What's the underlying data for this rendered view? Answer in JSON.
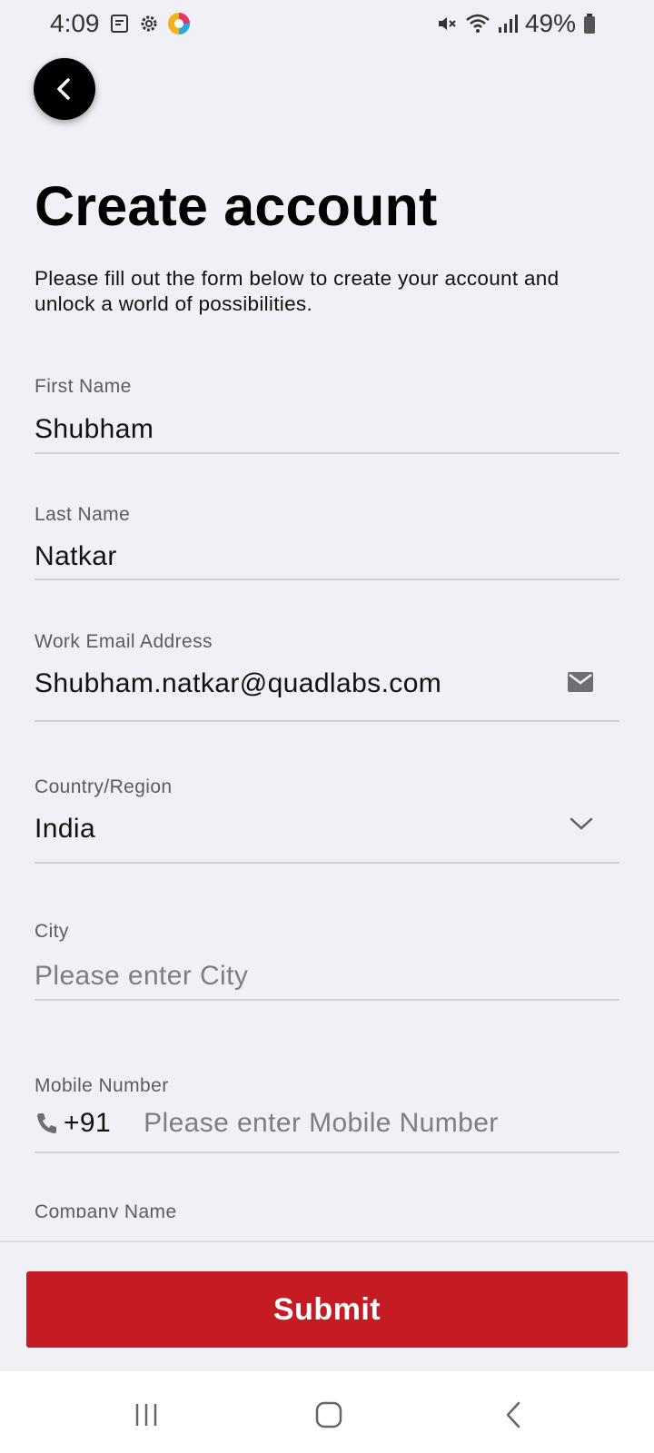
{
  "status_bar": {
    "time": "4:09",
    "battery_percent": "49%",
    "left_icons": [
      "notes-icon",
      "gear-icon",
      "app-icon"
    ],
    "right_icons": [
      "mute-icon",
      "wifi-icon",
      "signal-icon",
      "battery-icon"
    ]
  },
  "header": {
    "title": "Create account",
    "subtitle": "Please fill out the form below to create your account and unlock a world of possibilities."
  },
  "form": {
    "first_name": {
      "label": "First Name",
      "value": "Shubham"
    },
    "last_name": {
      "label": "Last Name",
      "value": "Natkar"
    },
    "email": {
      "label": "Work Email Address",
      "value": "Shubham.natkar@quadlabs.com",
      "icon": "mail-icon"
    },
    "country": {
      "label": "Country/Region",
      "value": "India",
      "icon": "chevron-down-icon"
    },
    "city": {
      "label": "City",
      "placeholder": "Please enter City"
    },
    "mobile": {
      "label": "Mobile Number",
      "prefix": "+91",
      "placeholder": "Please enter Mobile Number",
      "icon": "phone-icon"
    },
    "company": {
      "label": "Company Name"
    }
  },
  "actions": {
    "submit_label": "Submit"
  },
  "colors": {
    "accent": "#c51b22",
    "background": "#f1f0f6",
    "back_button": "#000000"
  },
  "nav_bar": {
    "buttons": [
      "recent-apps-icon",
      "home-icon",
      "back-icon"
    ]
  }
}
